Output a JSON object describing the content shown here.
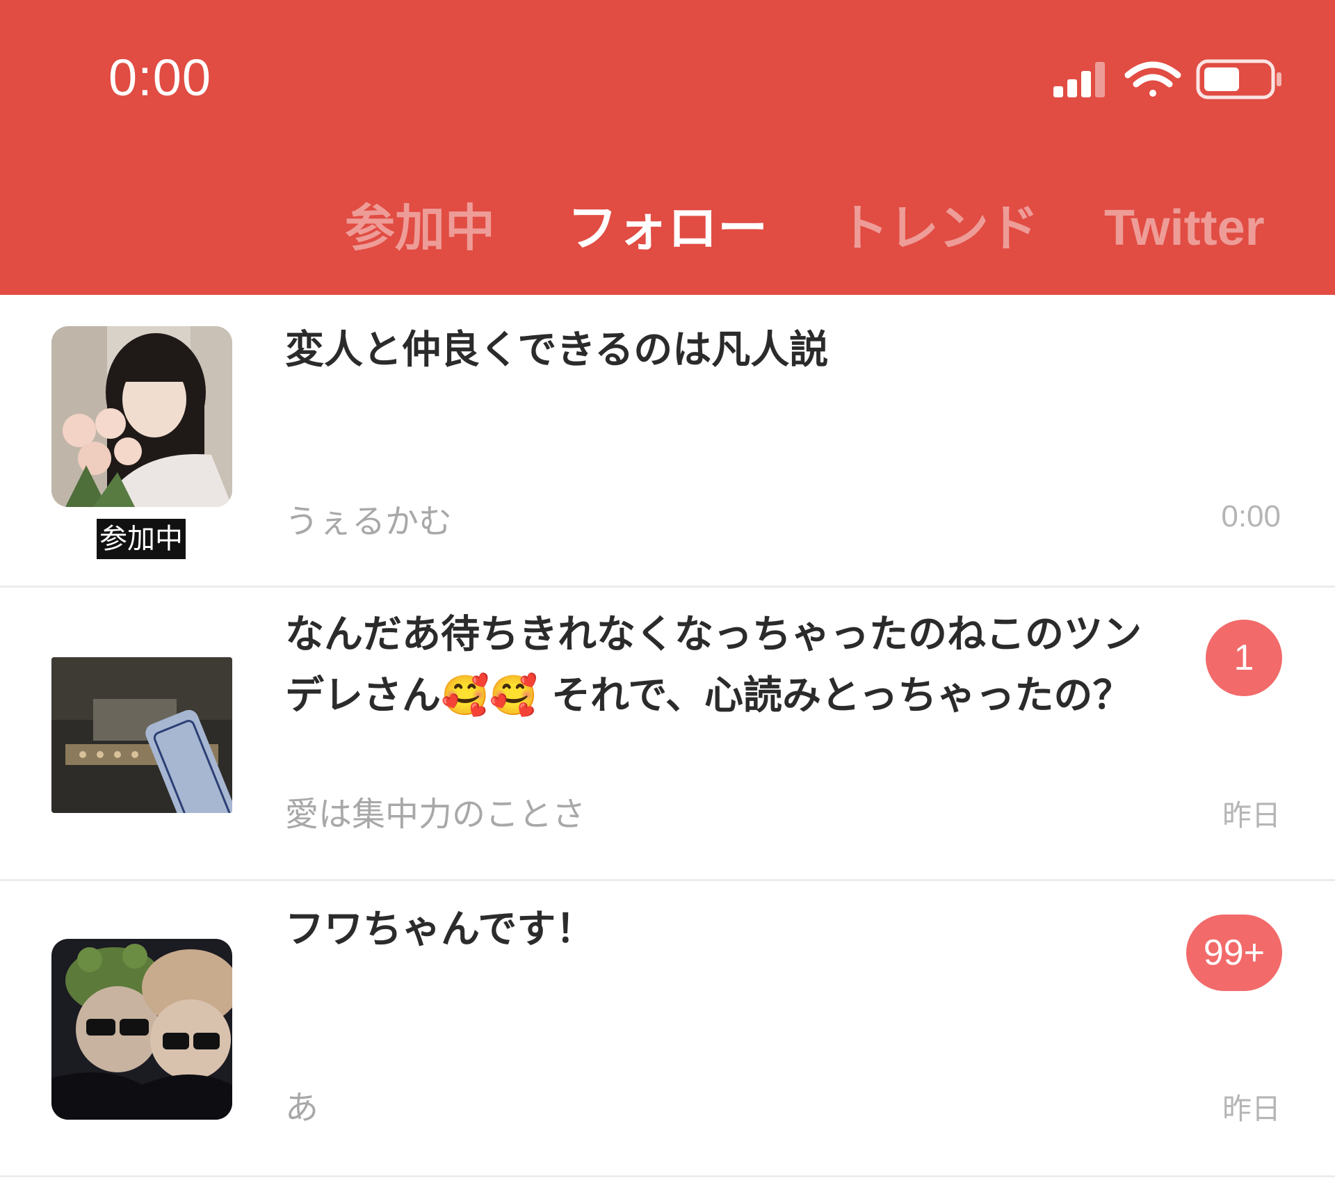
{
  "status_bar": {
    "time": "0:00"
  },
  "tabs": [
    {
      "label": "参加中",
      "active": false
    },
    {
      "label": "フォロー",
      "active": true
    },
    {
      "label": "トレンド",
      "active": false
    },
    {
      "label": "Twitter",
      "active": false
    }
  ],
  "colors": {
    "header": "#e14c43",
    "badge": "#f26a6a",
    "title_text": "#2b2b2b",
    "meta_text": "#a8a8a8"
  },
  "rooms": [
    {
      "title": "変人と仲良くできるのは凡人説",
      "subtitle": "うぇるかむ",
      "time": "0:00",
      "tag": "参加中",
      "badge": null
    },
    {
      "title": " なんだあ待ちきれなくなっちゃったのねこのツンデレさん🥰🥰 それで、心読みとっちゃったの？",
      "subtitle": "愛は集中力のことさ",
      "time": "昨日",
      "tag": null,
      "badge": "1"
    },
    {
      "title": "フワちゃんです！",
      "subtitle": "あ",
      "time": "昨日",
      "tag": null,
      "badge": "99+"
    }
  ]
}
